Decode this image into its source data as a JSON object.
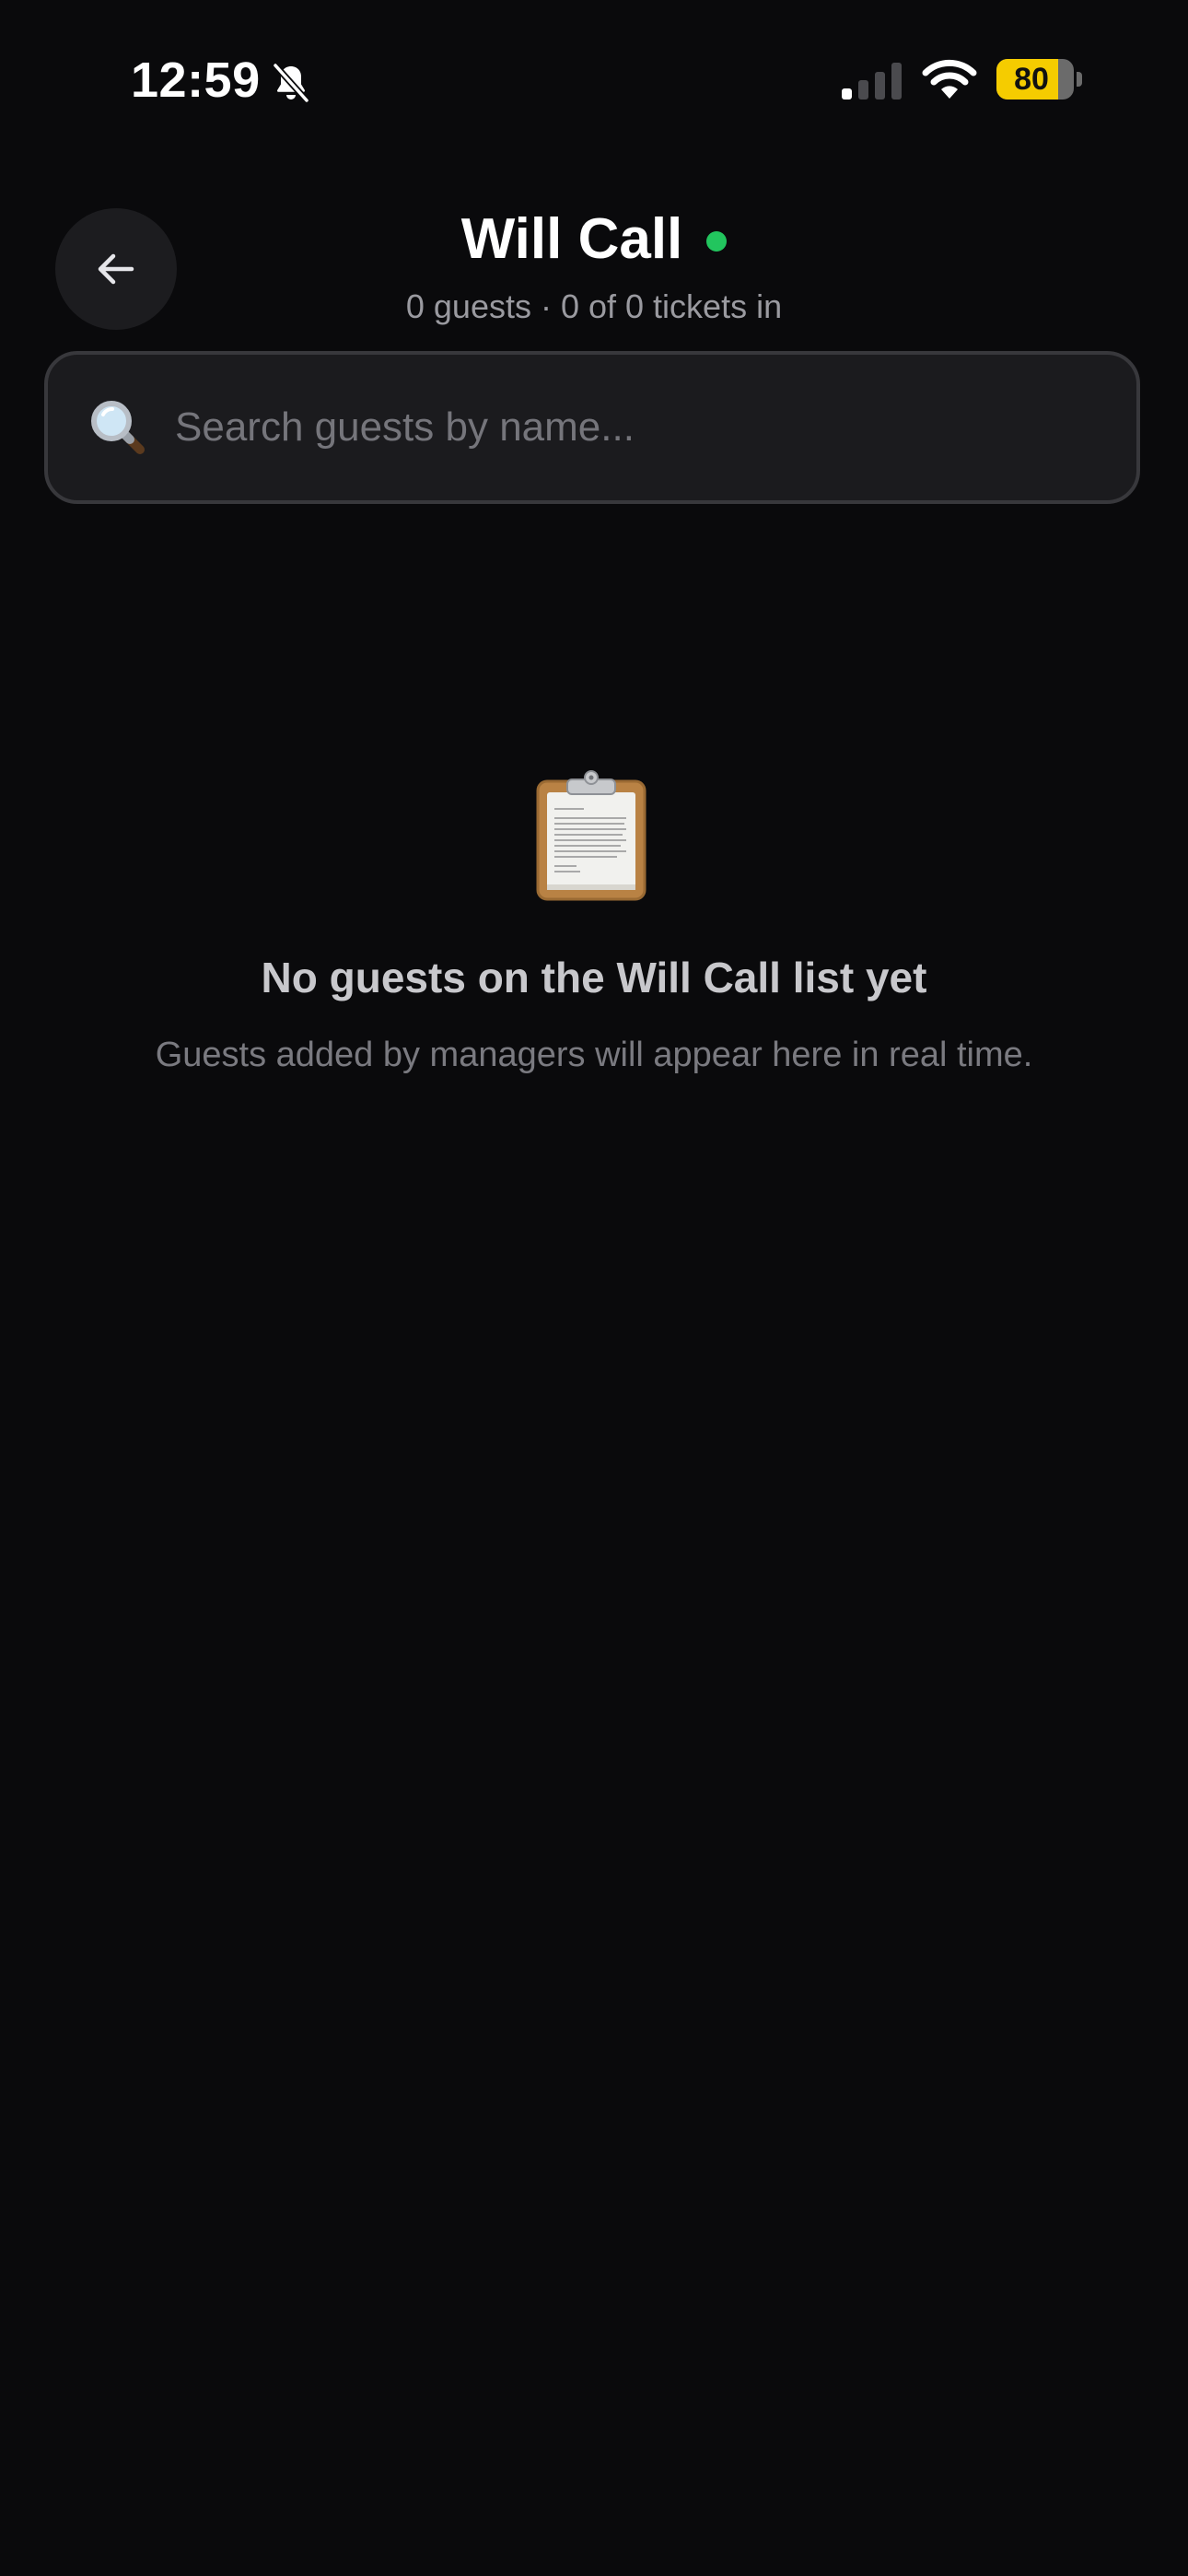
{
  "status_bar": {
    "time": "12:59",
    "battery_level": "80",
    "battery_fill_fraction": 0.8,
    "icons": [
      "bell-slash-icon",
      "cellular-signal-icon",
      "wifi-icon",
      "battery-icon"
    ]
  },
  "header": {
    "title": "Will Call",
    "subtitle": "0 guests · 0 of 0 tickets in",
    "back_icon": "arrow-left-icon",
    "live_status_color": "#22c55e"
  },
  "search": {
    "icon": "magnifying-glass-icon",
    "placeholder": "Search guests by name...",
    "value": ""
  },
  "empty_state": {
    "icon": "clipboard-icon",
    "title": "No guests on the Will Call list yet",
    "message": "Guests added by managers will appear here in real time."
  },
  "colors": {
    "background": "#0a0a0c",
    "surface": "#1b1b1e",
    "accent_live": "#22c55e",
    "battery": "#f5cc00"
  }
}
